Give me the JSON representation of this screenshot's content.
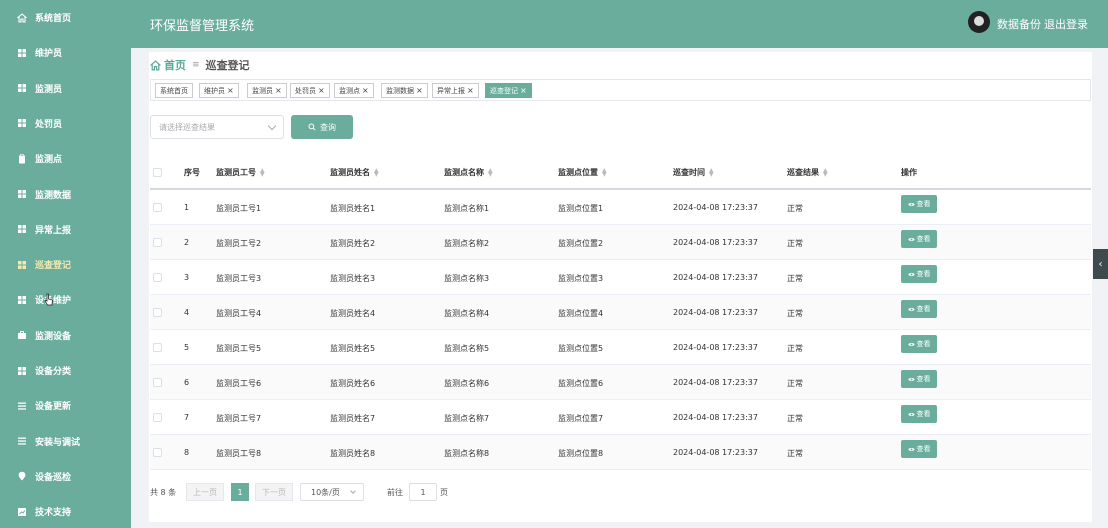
{
  "header": {
    "app_title": "环保监督管理系统",
    "backup_label": "数据备份",
    "logout_label": "退出登录"
  },
  "sidebar": {
    "items": [
      {
        "label": "系统首页",
        "icon": "home-icon"
      },
      {
        "label": "维护员",
        "icon": "grid-icon"
      },
      {
        "label": "监测员",
        "icon": "grid-icon"
      },
      {
        "label": "处罚员",
        "icon": "grid-icon"
      },
      {
        "label": "监测点",
        "icon": "clipboard-icon"
      },
      {
        "label": "监测数据",
        "icon": "grid-icon"
      },
      {
        "label": "异常上报",
        "icon": "grid-icon"
      },
      {
        "label": "巡查登记",
        "icon": "grid-icon",
        "active": true
      },
      {
        "label": "设备维护",
        "icon": "grid-icon"
      },
      {
        "label": "监测设备",
        "icon": "briefcase-icon"
      },
      {
        "label": "设备分类",
        "icon": "grid-icon"
      },
      {
        "label": "设备更新",
        "icon": "list-icon"
      },
      {
        "label": "安装与调试",
        "icon": "list-icon"
      },
      {
        "label": "设备巡检",
        "icon": "location-icon"
      },
      {
        "label": "技术支持",
        "icon": "chart-icon"
      }
    ]
  },
  "breadcrumb": {
    "home": "首页",
    "separator": "≡",
    "current": "巡查登记"
  },
  "tags": [
    {
      "label": "系统首页",
      "closable": false
    },
    {
      "label": "维护员",
      "closable": true
    },
    {
      "label": "监测员",
      "closable": true
    },
    {
      "label": "处罚员",
      "closable": true
    },
    {
      "label": "监测点",
      "closable": true
    },
    {
      "label": "监测数据",
      "closable": true
    },
    {
      "label": "异常上报",
      "closable": true
    },
    {
      "label": "巡查登记",
      "closable": true,
      "active": true
    }
  ],
  "tag_close_glyph": "×",
  "filter": {
    "placeholder": "请选择巡查结果",
    "search_label": "查询"
  },
  "table": {
    "columns": [
      "序号",
      "监测员工号",
      "监测员姓名",
      "监测点名称",
      "监测点位置",
      "巡查时间",
      "巡查结果",
      "操作"
    ],
    "view_label": "查看",
    "rows": [
      {
        "index": "1",
        "staff_no": "监测员工号1",
        "staff_name": "监测员姓名1",
        "point_name": "监测点名称1",
        "point_location": "监测点位置1",
        "time": "2024-04-08 17:23:37",
        "result": "正常"
      },
      {
        "index": "2",
        "staff_no": "监测员工号2",
        "staff_name": "监测员姓名2",
        "point_name": "监测点名称2",
        "point_location": "监测点位置2",
        "time": "2024-04-08 17:23:37",
        "result": "正常"
      },
      {
        "index": "3",
        "staff_no": "监测员工号3",
        "staff_name": "监测员姓名3",
        "point_name": "监测点名称3",
        "point_location": "监测点位置3",
        "time": "2024-04-08 17:23:37",
        "result": "正常"
      },
      {
        "index": "4",
        "staff_no": "监测员工号4",
        "staff_name": "监测员姓名4",
        "point_name": "监测点名称4",
        "point_location": "监测点位置4",
        "time": "2024-04-08 17:23:37",
        "result": "正常"
      },
      {
        "index": "5",
        "staff_no": "监测员工号5",
        "staff_name": "监测员姓名5",
        "point_name": "监测点名称5",
        "point_location": "监测点位置5",
        "time": "2024-04-08 17:23:37",
        "result": "正常"
      },
      {
        "index": "6",
        "staff_no": "监测员工号6",
        "staff_name": "监测员姓名6",
        "point_name": "监测点名称6",
        "point_location": "监测点位置6",
        "time": "2024-04-08 17:23:37",
        "result": "正常"
      },
      {
        "index": "7",
        "staff_no": "监测员工号7",
        "staff_name": "监测员姓名7",
        "point_name": "监测点名称7",
        "point_location": "监测点位置7",
        "time": "2024-04-08 17:23:37",
        "result": "正常"
      },
      {
        "index": "8",
        "staff_no": "监测员工号8",
        "staff_name": "监测员姓名8",
        "point_name": "监测点名称8",
        "point_location": "监测点位置8",
        "time": "2024-04-08 17:23:37",
        "result": "正常"
      }
    ]
  },
  "pagination": {
    "total": "共 8 条",
    "prev": "上一页",
    "current_page": "1",
    "next": "下一页",
    "page_size": "10条/页",
    "goto_label": "前往",
    "goto_value": "1",
    "goto_suffix": "页"
  },
  "collapse_glyph": "‹",
  "colors": {
    "primary": "#6aad9c",
    "active_text": "#f6e9b0"
  }
}
